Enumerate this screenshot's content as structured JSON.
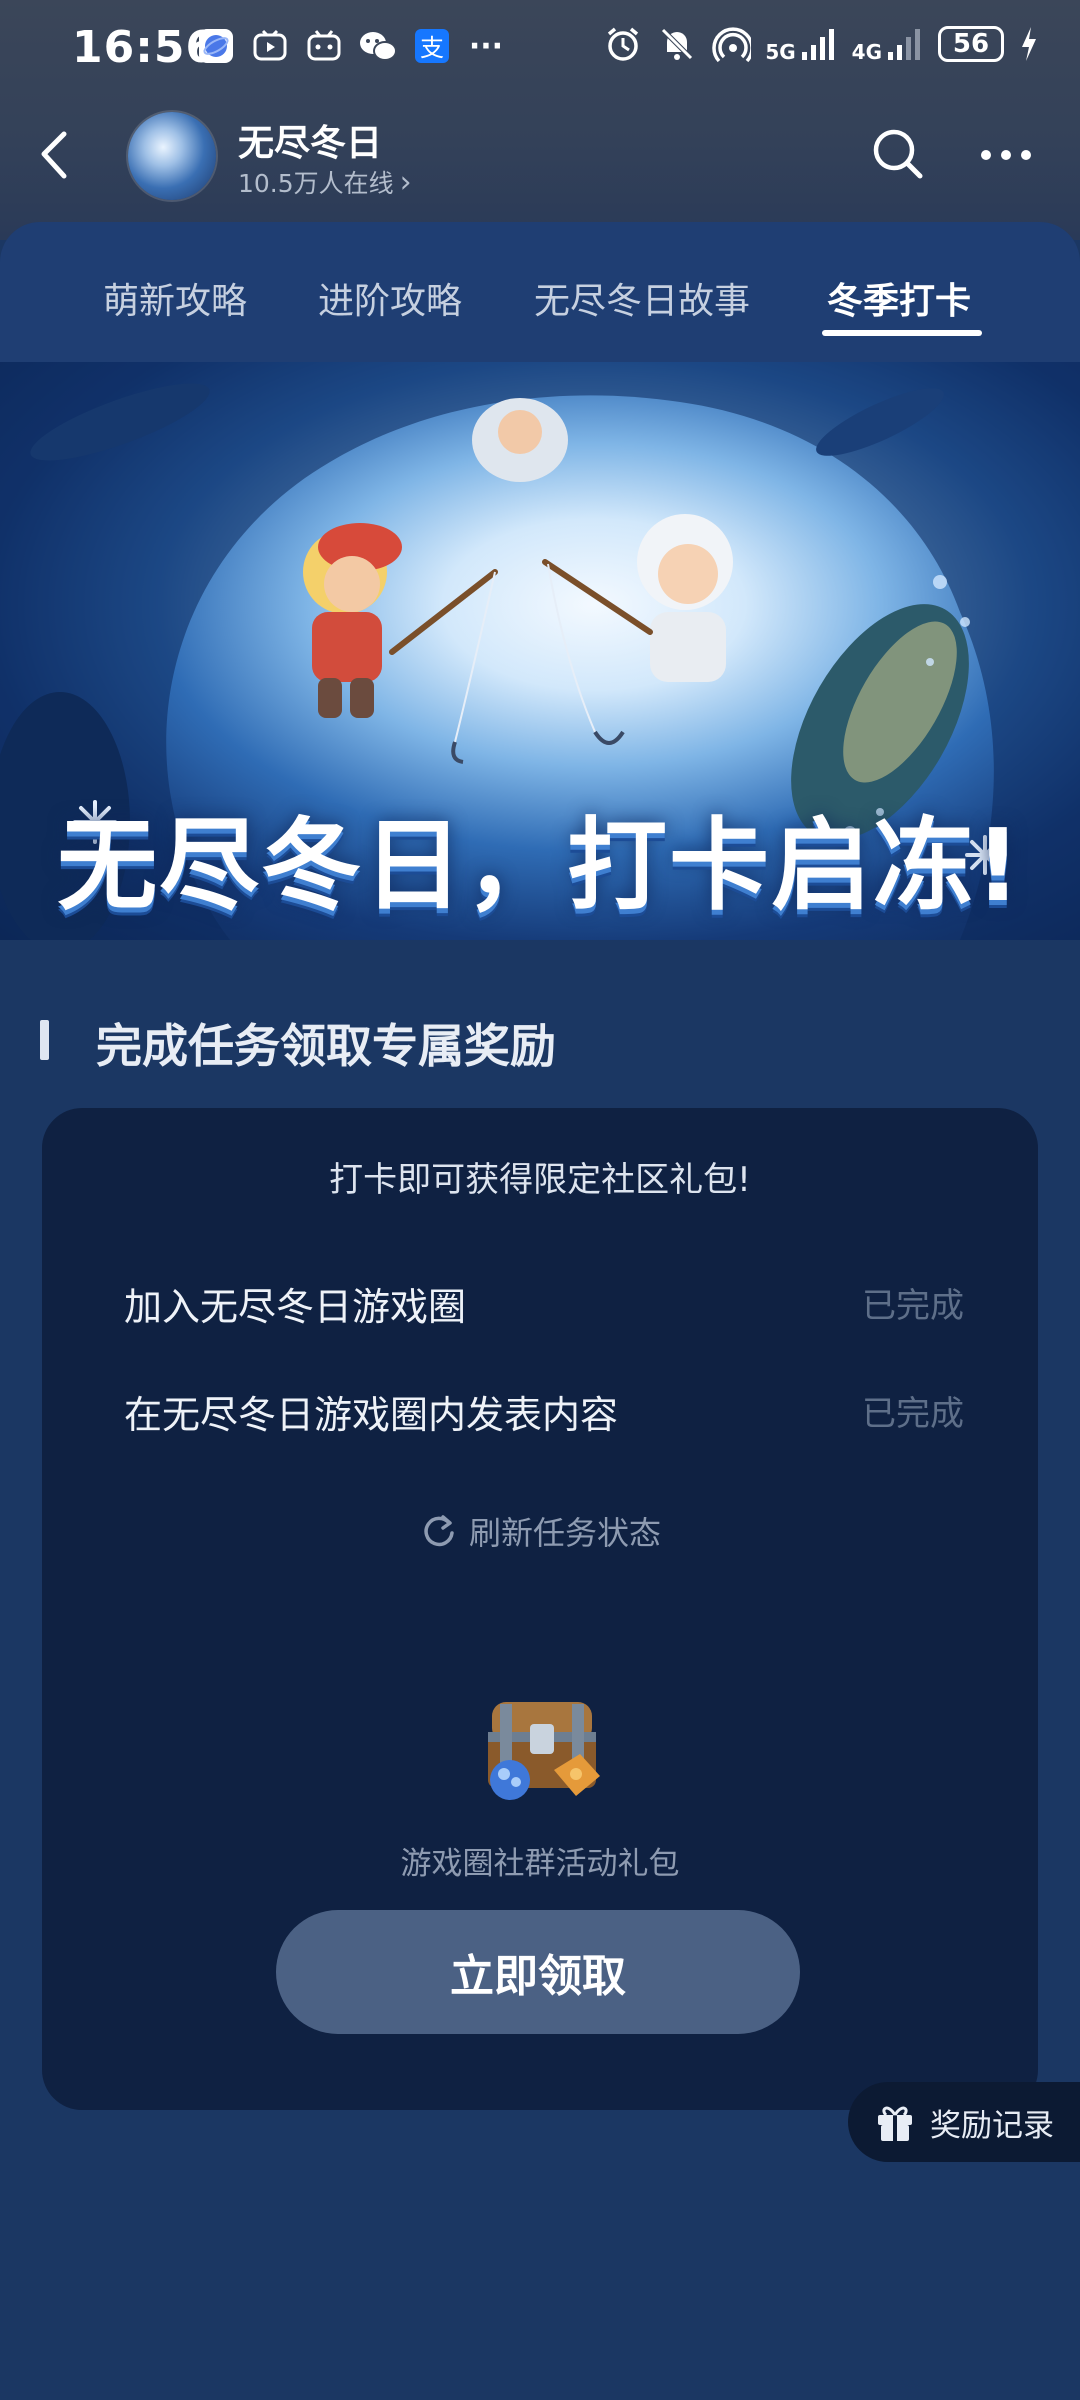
{
  "status_bar": {
    "time": "16:56",
    "signal_1": "5G",
    "signal_2": "4G",
    "battery": "56",
    "more_dots": "···"
  },
  "header": {
    "title": "无尽冬日",
    "online": "10.5万人在线",
    "online_chevron": "›"
  },
  "tabs": [
    {
      "label": "萌新攻略",
      "active": false
    },
    {
      "label": "进阶攻略",
      "active": false
    },
    {
      "label": "无尽冬日故事",
      "active": false
    },
    {
      "label": "冬季打卡",
      "active": true
    }
  ],
  "banner": {
    "slogan": "无尽冬日，打卡启冻!"
  },
  "section": {
    "title": "完成任务领取专属奖励"
  },
  "task_card": {
    "headline": "打卡即可获得限定社区礼包!",
    "tasks": [
      {
        "label": "加入无尽冬日游戏圈",
        "status": "已完成"
      },
      {
        "label": "在无尽冬日游戏圈内发表内容",
        "status": "已完成"
      }
    ],
    "refresh_label": "刷新任务状态",
    "gift_name": "游戏圈社群活动礼包",
    "claim_label": "立即领取"
  },
  "reward_record": {
    "label": "奖励记录"
  },
  "colors": {
    "background": "#1b3763",
    "card": "#0f2142",
    "claim_button": "#4b6184",
    "tab_active": "#ffffff",
    "status_done": "#5e6f89"
  }
}
